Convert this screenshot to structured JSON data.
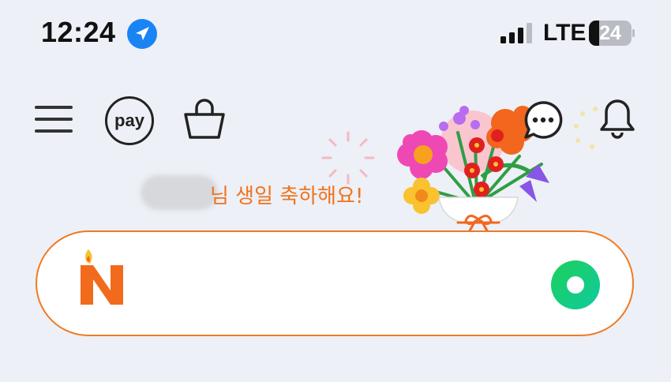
{
  "status_bar": {
    "time": "12:24",
    "location_icon": "location-arrow-icon",
    "signal_icon": "cellular-signal-icon",
    "network": "LTE",
    "battery_level": "24",
    "battery_fraction": 0.24
  },
  "header": {
    "menu_icon": "hamburger-menu-icon",
    "pay_label": "pay",
    "shopping_icon": "shopping-bag-icon",
    "chat_icon": "chat-bubble-icon",
    "notification_icon": "bell-icon"
  },
  "birthday": {
    "message": "님 생일 축하해요!",
    "illustration": "flower-bouquet-icon"
  },
  "search": {
    "placeholder": "",
    "value": "",
    "logo_icon": "naver-n-birthday-logo",
    "lens_icon": "green-lens-icon"
  },
  "colors": {
    "background": "#edf0f6",
    "accent_orange": "#f07a22",
    "lens_green": "#19d26e",
    "location_blue": "#1a84f5"
  }
}
